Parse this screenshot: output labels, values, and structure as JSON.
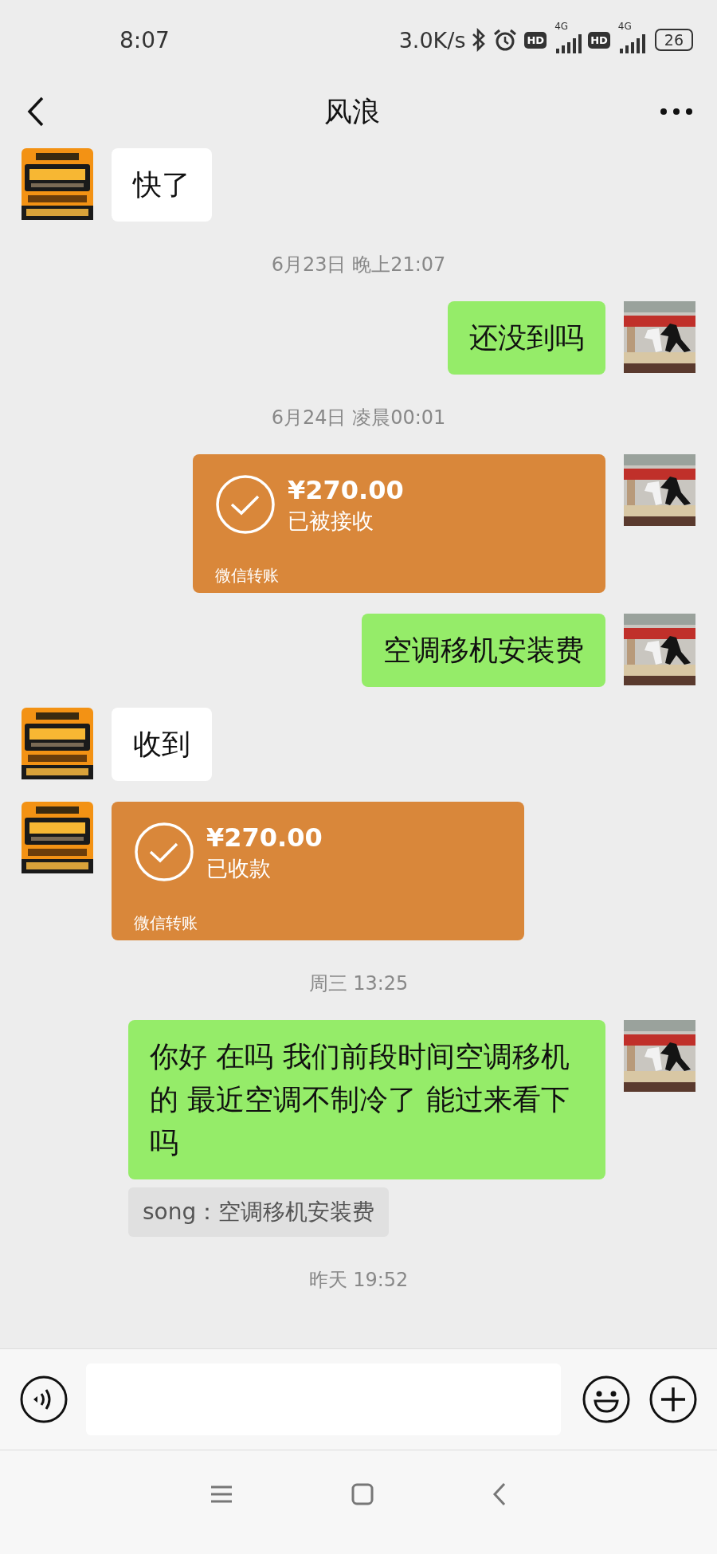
{
  "status_bar": {
    "time": "8:07",
    "net_speed": "3.0K/s",
    "sims": [
      {
        "hd": "HD",
        "net": "4G"
      },
      {
        "hd": "HD",
        "net": "4G"
      }
    ],
    "battery": "26"
  },
  "header": {
    "title": "风浪"
  },
  "messages": [
    {
      "kind": "text",
      "outgoing": false,
      "text": "快了"
    },
    {
      "kind": "time",
      "text": "6月23日 晚上21:07"
    },
    {
      "kind": "text",
      "outgoing": true,
      "text": "还没到吗"
    },
    {
      "kind": "time",
      "text": "6月24日 凌晨00:01"
    },
    {
      "kind": "transfer",
      "outgoing": true,
      "amount": "¥270.00",
      "status": "已被接收",
      "label": "微信转账"
    },
    {
      "kind": "text",
      "outgoing": true,
      "text": "空调移机安装费"
    },
    {
      "kind": "text",
      "outgoing": false,
      "text": "收到"
    },
    {
      "kind": "transfer",
      "outgoing": false,
      "amount": "¥270.00",
      "status": "已收款",
      "label": "微信转账"
    },
    {
      "kind": "time",
      "text": "周三 13:25"
    },
    {
      "kind": "text",
      "outgoing": true,
      "text": "你好 在吗 我们前段时间空调移机的 最近空调不制冷了 能过来看下吗",
      "quote": "song：空调移机安装费"
    },
    {
      "kind": "time",
      "text": "昨天 19:52"
    }
  ]
}
